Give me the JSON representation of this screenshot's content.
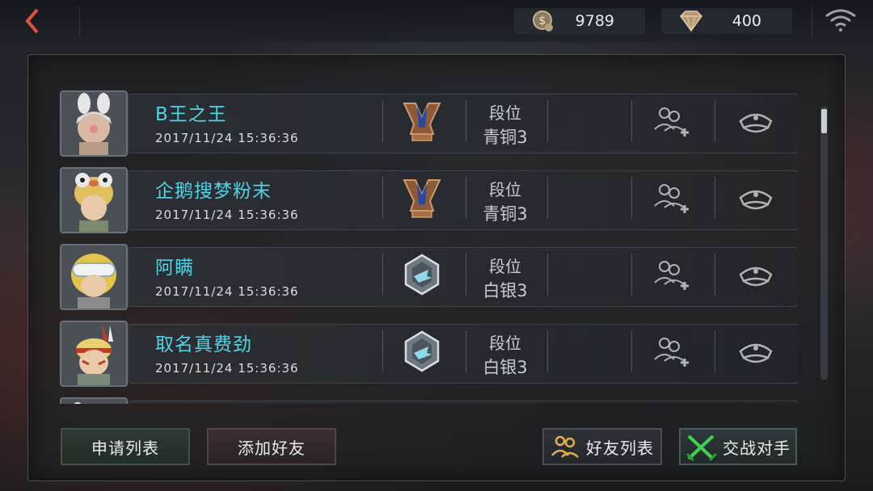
{
  "topbar": {
    "coins": "9789",
    "diamonds": "400",
    "icons": [
      "back-arrow-icon",
      "coin-icon",
      "diamond-icon",
      "wifi-icon"
    ]
  },
  "players": [
    {
      "name": "B王之王",
      "time": "2017/11/24 15:36:36",
      "rank_title": "段位",
      "rank_value": "青铜3",
      "rank_tier": "bronze"
    },
    {
      "name": "企鹅搜梦粉末",
      "time": "2017/11/24 15:36:36",
      "rank_title": "段位",
      "rank_value": "青铜3",
      "rank_tier": "bronze"
    },
    {
      "name": "阿瞒",
      "time": "2017/11/24 15:36:36",
      "rank_title": "段位",
      "rank_value": "白银3",
      "rank_tier": "silver"
    },
    {
      "name": "取名真费劲",
      "time": "2017/11/24 15:36:36",
      "rank_title": "段位",
      "rank_value": "白银3",
      "rank_tier": "silver"
    }
  ],
  "buttons": {
    "apply_list": "申请列表",
    "add_friend": "添加好友",
    "friend_list": "好友列表",
    "battle": "交战对手"
  },
  "colors": {
    "name_accent": "#4fd3e6",
    "back_arrow": "#e0513d",
    "battle_icon": "#3fd24a",
    "friend_icon": "#e2b04a"
  }
}
